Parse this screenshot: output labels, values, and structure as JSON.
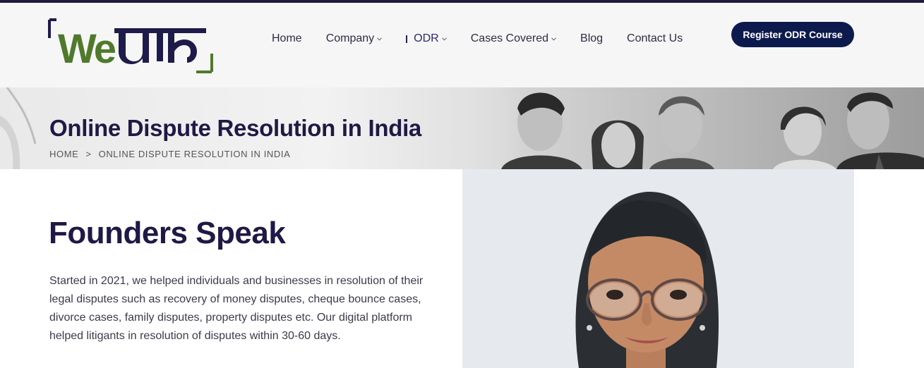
{
  "logo": {
    "text": "WeVaad",
    "colors": {
      "we": "#4f7a2c",
      "vaad": "#1e1b4b",
      "bracket_top": "#1e1b4b",
      "bracket_bottom": "#4f7a2c"
    }
  },
  "nav": {
    "items": [
      {
        "label": "Home",
        "has_dropdown": false,
        "active": false
      },
      {
        "label": "Company",
        "has_dropdown": true,
        "active": false
      },
      {
        "label": "ODR",
        "has_dropdown": true,
        "active": true
      },
      {
        "label": "Cases Covered",
        "has_dropdown": true,
        "active": false
      },
      {
        "label": "Blog",
        "has_dropdown": false,
        "active": false
      },
      {
        "label": "Contact Us",
        "has_dropdown": false,
        "active": false
      }
    ],
    "cta_label": "Register ODR Course"
  },
  "banner": {
    "title": "Online Dispute Resolution in India",
    "breadcrumb": {
      "home": "HOME",
      "separator": ">",
      "current": "ONLINE DISPUTE RESOLUTION IN INDIA"
    }
  },
  "section": {
    "title": "Founders Speak",
    "body": "Started in 2021, we helped individuals and businesses in resolution of their legal disputes such as recovery of money disputes, cheque bounce cases, divorce cases, family disputes, property disputes etc. Our digital platform helped litigants in resolution of disputes within 30-60 days."
  },
  "colors": {
    "accent": "#0d1a4d",
    "heading": "#1e1945",
    "topbar": "#201a3d",
    "header_bg": "#f6f6f6"
  }
}
